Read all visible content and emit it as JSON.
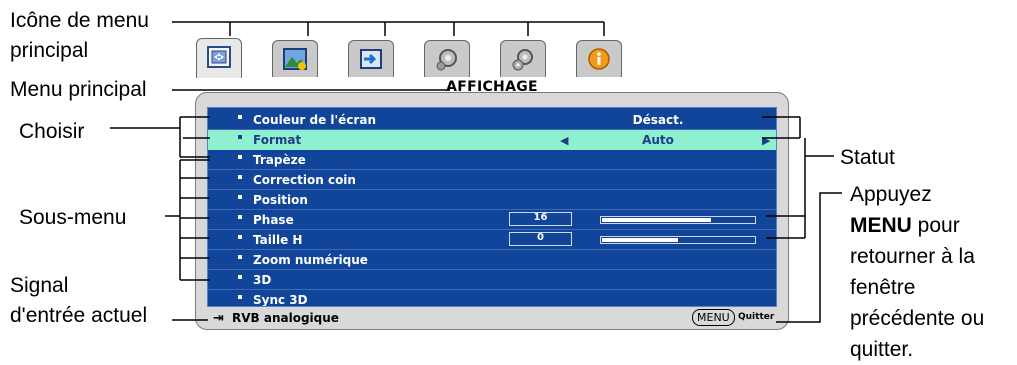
{
  "callouts": {
    "main_menu_icon": "Icône de menu\nprincipal",
    "main_menu": "Menu principal",
    "select": "Choisir",
    "submenu": "Sous-menu",
    "current_signal": "Signal\nd'entrée actuel",
    "status": "Statut",
    "press_prefix": "Appuyez",
    "press_key": "MENU",
    "press_suffix": " pour",
    "press_rest_1": "retourner à la",
    "press_rest_2": "fenêtre",
    "press_rest_3": "précédente ou",
    "press_rest_4": "quitter."
  },
  "osd": {
    "title": "AFFICHAGE",
    "tabs": [
      {
        "icon": "display-settings-icon"
      },
      {
        "icon": "picture-icon"
      },
      {
        "icon": "source-icon"
      },
      {
        "icon": "setup-basic-icon"
      },
      {
        "icon": "setup-advanced-icon"
      },
      {
        "icon": "information-icon"
      }
    ],
    "rows": [
      {
        "label": "Couleur de l'écran",
        "status": "Désact."
      },
      {
        "label": "Format",
        "status": "Auto"
      },
      {
        "label": "Trapèze",
        "status": ""
      },
      {
        "label": "Correction coin",
        "status": ""
      },
      {
        "label": "Position",
        "status": ""
      },
      {
        "label": "Phase",
        "value": "16",
        "level": 0.72
      },
      {
        "label": "Taille H",
        "value": "0",
        "level": 0.5
      },
      {
        "label": "Zoom numérique",
        "status": ""
      },
      {
        "label": "3D",
        "status": ""
      },
      {
        "label": "Sync 3D",
        "status": ""
      }
    ],
    "source_label": "RVB analogique",
    "menu_key": "MENU",
    "quit_label": "Quitter"
  }
}
